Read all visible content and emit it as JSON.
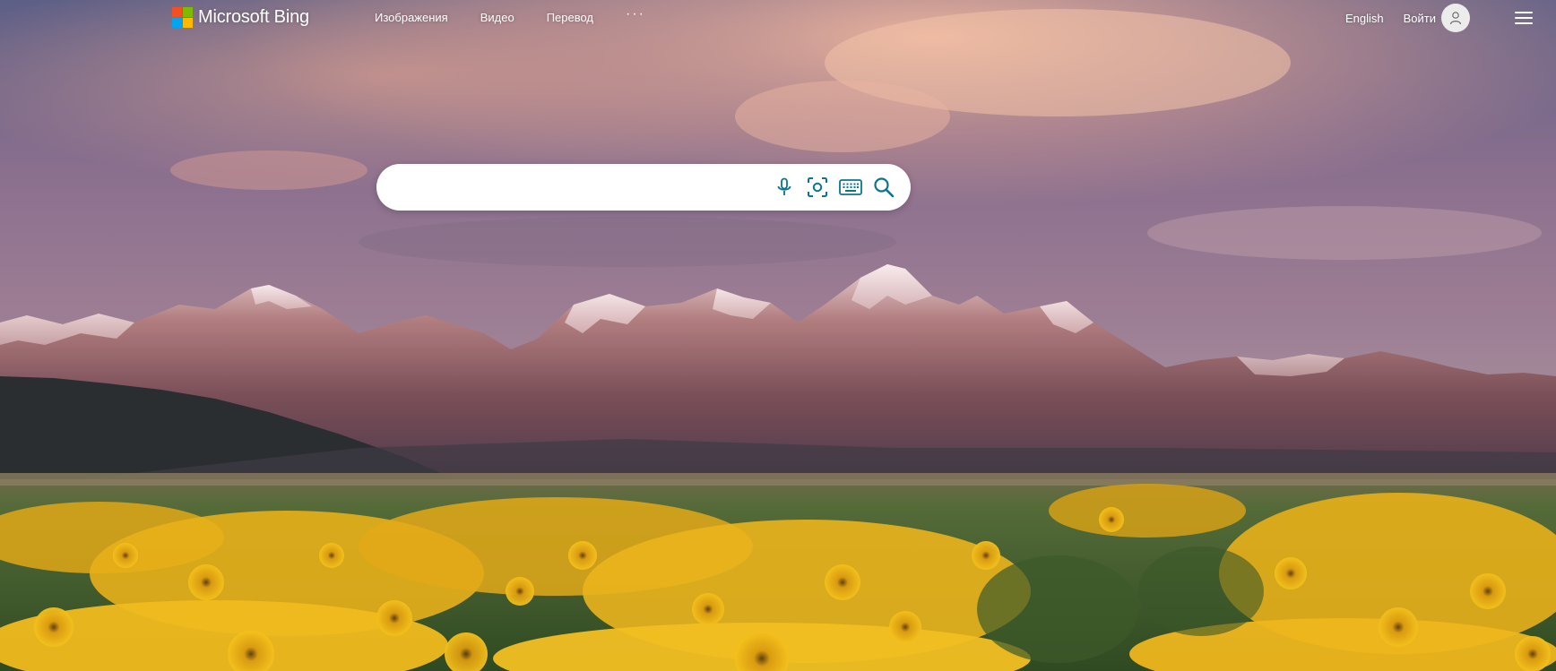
{
  "header": {
    "logo_text": "Microsoft Bing",
    "nav": [
      {
        "label": "Изображения"
      },
      {
        "label": "Видео"
      },
      {
        "label": "Перевод"
      }
    ],
    "more_label": "···",
    "language_label": "English",
    "signin_label": "Войти"
  },
  "search": {
    "value": "",
    "placeholder": ""
  },
  "colors": {
    "ms_red": "#f25022",
    "ms_green": "#7fba00",
    "ms_blue": "#00a4ef",
    "ms_yellow": "#ffb900",
    "search_icon": "#0b7590"
  },
  "icons": {
    "microphone": "microphone-icon",
    "visual_search": "visual-search-icon",
    "keyboard": "keyboard-icon",
    "search": "search-icon",
    "user": "user-icon",
    "menu": "hamburger-menu-icon"
  }
}
